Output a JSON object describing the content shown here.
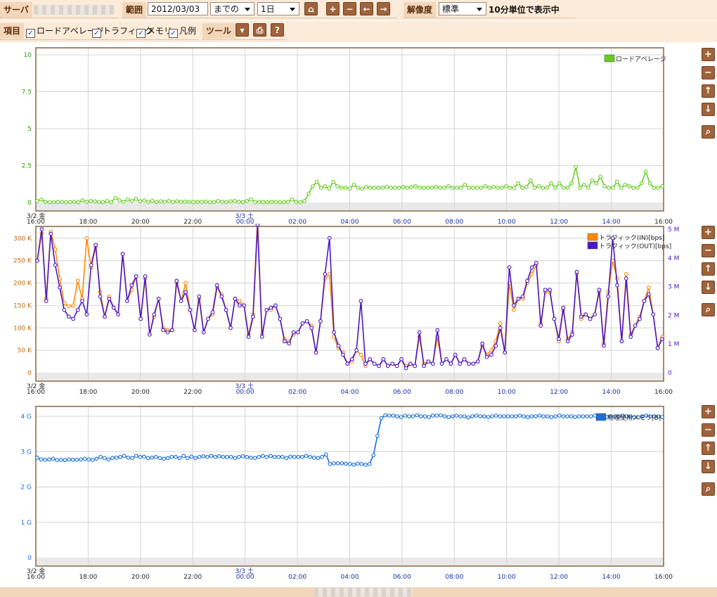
{
  "toolbar": {
    "server_label": "サーバ",
    "range_label": "範囲",
    "date_value": "2012/03/03",
    "until_value": "までの",
    "span_value": "1日",
    "resolution_label": "解像度",
    "resolution_value": "標準",
    "resolution_status": "10分単位で表示中",
    "items_label": "項目",
    "checks": [
      {
        "label": "ロードアベレージ",
        "checked": true
      },
      {
        "label": "トラフィック",
        "checked": true
      },
      {
        "label": "メモリ",
        "checked": true
      },
      {
        "label": "凡例",
        "checked": true
      }
    ],
    "tools_label": "ツール",
    "buttons": {
      "home": "⌂",
      "plus": "+",
      "minus": "−",
      "left": "←",
      "right": "→",
      "tool_menu": "▾",
      "print": "⎙",
      "help": "?"
    }
  },
  "side_buttons": {
    "zoom_in": "+",
    "zoom_out": "−",
    "up": "↑",
    "down": "↓",
    "search": "⌕"
  },
  "x_axis": {
    "ticks": [
      "16:00",
      "18:00",
      "20:00",
      "22:00",
      "00:00",
      "02:00",
      "04:00",
      "06:00",
      "08:00",
      "10:00",
      "12:00",
      "14:00",
      "16:00"
    ],
    "day1": "3/2 金",
    "day2": "3/3 土"
  },
  "colors": {
    "load": "#66cc22",
    "traffic_in": "#ff8800",
    "traffic_out": "#4b18c8",
    "memory": "#1a6fd8",
    "grid": "#d4d4d4",
    "frame": "#a48a70"
  },
  "chart_data": [
    {
      "type": "line",
      "legend": "top-right",
      "ylim": [
        0,
        10
      ],
      "y_ticks": [
        "0",
        "2.5",
        "5",
        "7.5",
        "10"
      ],
      "series": [
        {
          "name": "ロードアベレージ",
          "values": [
            0.1,
            0.2,
            0.05,
            0.02,
            0.02,
            0.03,
            0.04,
            0.02,
            0.03,
            0.05,
            0.02,
            0.15,
            0.05,
            0.1,
            0.08,
            0.04,
            0.02,
            0.1,
            0.02,
            0.3,
            0.15,
            0.05,
            0.2,
            0.1,
            0.25,
            0.08,
            0.15,
            0.05,
            0.1,
            0.03,
            0.08,
            0.05,
            0.1,
            0.04,
            0.08,
            0.05,
            0.06,
            0.04,
            0.03,
            0.05,
            0.04,
            0.06,
            0.02,
            0.04,
            0.1,
            0.05,
            0.03,
            0.08,
            0.1,
            0.05,
            0.03,
            0.1,
            0.2,
            0.04,
            0.05,
            0.03,
            0.02,
            0.05,
            0.04,
            0.02,
            0.04,
            0.05,
            0.2,
            0.05,
            0.02,
            0.1,
            0.6,
            1.1,
            1.4,
            1.0,
            1.1,
            0.95,
            1.4,
            1.1,
            1.0,
            1.0,
            0.95,
            1.2,
            1.0,
            0.95,
            1.05,
            1.0,
            1.0,
            1.0,
            1.0,
            1.05,
            1.0,
            1.0,
            1.0,
            1.05,
            1.0,
            1.05,
            1.1,
            1.0,
            1.0,
            1.0,
            1.0,
            1.05,
            1.0,
            1.0,
            1.1,
            1.0,
            1.0,
            1.0,
            1.2,
            1.0,
            1.0,
            1.0,
            1.0,
            1.1,
            1.0,
            1.05,
            1.0,
            1.0,
            1.1,
            1.0,
            1.0,
            1.3,
            1.0,
            1.05,
            1.5,
            1.0,
            1.1,
            1.0,
            1.0,
            1.3,
            1.0,
            1.3,
            1.0,
            1.0,
            1.3,
            2.4,
            1.0,
            1.2,
            1.0,
            1.5,
            1.3,
            1.75,
            1.1,
            1.0,
            1.0,
            1.4,
            1.0,
            1.2,
            1.1,
            1.0,
            1.0,
            1.3,
            2.1,
            1.3,
            1.0,
            1.0,
            1.1
          ]
        }
      ]
    },
    {
      "type": "line",
      "legend": "top-right",
      "ylim": [
        0,
        320
      ],
      "y_ticks": [
        "0",
        "50 K",
        "100 K",
        "150 K",
        "200 K",
        "250 K",
        "300 K"
      ],
      "y2_ticks": [
        "0",
        "1 M",
        "2 M",
        "3 M",
        "4 M",
        "5 M"
      ],
      "series": [
        {
          "name": "トラフィック(IN)[bps]",
          "values": [
            250,
            310,
            165,
            315,
            275,
            210,
            155,
            148,
            150,
            205,
            165,
            300,
            235,
            280,
            180,
            125,
            170,
            145,
            130,
            265,
            160,
            185,
            215,
            120,
            210,
            85,
            125,
            165,
            100,
            95,
            95,
            200,
            160,
            200,
            140,
            95,
            165,
            90,
            120,
            130,
            190,
            175,
            140,
            100,
            165,
            160,
            150,
            85,
            130,
            345,
            85,
            140,
            140,
            150,
            120,
            75,
            70,
            85,
            90,
            110,
            115,
            105,
            45,
            115,
            210,
            220,
            80,
            55,
            45,
            20,
            25,
            50,
            40,
            15,
            30,
            20,
            15,
            30,
            15,
            20,
            15,
            30,
            15,
            20,
            15,
            80,
            20,
            25,
            20,
            80,
            20,
            30,
            20,
            40,
            20,
            30,
            20,
            20,
            25,
            60,
            40,
            50,
            70,
            110,
            45,
            200,
            140,
            165,
            165,
            200,
            220,
            240,
            110,
            180,
            180,
            120,
            70,
            140,
            75,
            90,
            220,
            120,
            130,
            120,
            130,
            180,
            65,
            180,
            250,
            210,
            70,
            220,
            85,
            105,
            125,
            160,
            190,
            130,
            55,
            80
          ]
        },
        {
          "name": "トラフィック(OUT)[bps]",
          "values": [
            250,
            320,
            160,
            310,
            240,
            190,
            140,
            125,
            120,
            140,
            160,
            130,
            240,
            285,
            170,
            125,
            165,
            145,
            130,
            265,
            160,
            195,
            215,
            120,
            215,
            85,
            130,
            165,
            95,
            90,
            95,
            205,
            160,
            180,
            140,
            95,
            170,
            90,
            120,
            135,
            195,
            170,
            140,
            100,
            165,
            150,
            150,
            80,
            125,
            330,
            80,
            140,
            145,
            150,
            120,
            70,
            65,
            90,
            90,
            110,
            115,
            100,
            45,
            115,
            220,
            300,
            90,
            60,
            40,
            20,
            30,
            50,
            160,
            20,
            30,
            20,
            15,
            30,
            15,
            20,
            15,
            30,
            10,
            20,
            15,
            90,
            15,
            25,
            20,
            95,
            20,
            30,
            20,
            40,
            20,
            30,
            20,
            20,
            25,
            65,
            35,
            40,
            60,
            100,
            45,
            235,
            150,
            165,
            170,
            205,
            235,
            245,
            105,
            185,
            185,
            120,
            75,
            145,
            70,
            85,
            225,
            125,
            130,
            120,
            130,
            185,
            60,
            170,
            300,
            195,
            70,
            210,
            80,
            105,
            120,
            160,
            175,
            130,
            55,
            75
          ]
        }
      ]
    },
    {
      "type": "line",
      "legend": "top-right",
      "ylim": [
        0,
        4.2
      ],
      "y_ticks": [
        "0",
        "1 G",
        "2 G",
        "3 G",
        "4 G"
      ],
      "series": [
        {
          "name": "物理使用メモリ[B]",
          "values": [
            2.83,
            2.78,
            2.77,
            2.78,
            2.8,
            2.76,
            2.77,
            2.76,
            2.78,
            2.77,
            2.77,
            2.78,
            2.8,
            2.78,
            2.77,
            2.8,
            2.85,
            2.82,
            2.78,
            2.82,
            2.83,
            2.85,
            2.88,
            2.83,
            2.82,
            2.88,
            2.85,
            2.86,
            2.82,
            2.83,
            2.85,
            2.82,
            2.8,
            2.82,
            2.85,
            2.85,
            2.82,
            2.88,
            2.82,
            2.86,
            2.82,
            2.85,
            2.87,
            2.85,
            2.88,
            2.85,
            2.87,
            2.85,
            2.85,
            2.85,
            2.82,
            2.85,
            2.87,
            2.85,
            2.83,
            2.82,
            2.85,
            2.88,
            2.85,
            2.88,
            2.85,
            2.85,
            2.85,
            2.82,
            2.86,
            2.85,
            2.85,
            2.85,
            2.88,
            2.85,
            2.83,
            2.82,
            2.85,
            2.92,
            2.65,
            2.67,
            2.67,
            2.67,
            2.66,
            2.65,
            2.63,
            2.66,
            2.65,
            2.63,
            2.65,
            2.9,
            3.45,
            3.95,
            4.03,
            4.02,
            4.02,
            4.0,
            3.98,
            4.02,
            4.0,
            4.0,
            4.03,
            4.0,
            4.0,
            3.98,
            4.02,
            4.02,
            4.03,
            4.0,
            3.98,
            4.0,
            4.02,
            4.0,
            4.0,
            3.97,
            4.0,
            4.02,
            4.0,
            4.0,
            3.98,
            4.0,
            4.02,
            4.0,
            4.0,
            4.0,
            4.0,
            4.0,
            4.02,
            4.0,
            3.98,
            4.0,
            4.0,
            4.02,
            4.0,
            4.0,
            3.98,
            4.0,
            4.02,
            4.0,
            4.0,
            4.0,
            3.98,
            4.0,
            4.0,
            4.0,
            4.0,
            4.02,
            4.0,
            4.0,
            3.98,
            4.0,
            4.0,
            4.0,
            4.02,
            4.0,
            4.0,
            3.98,
            3.97,
            4.0,
            4.02,
            4.0,
            4.0,
            4.0,
            3.98
          ]
        }
      ]
    }
  ]
}
